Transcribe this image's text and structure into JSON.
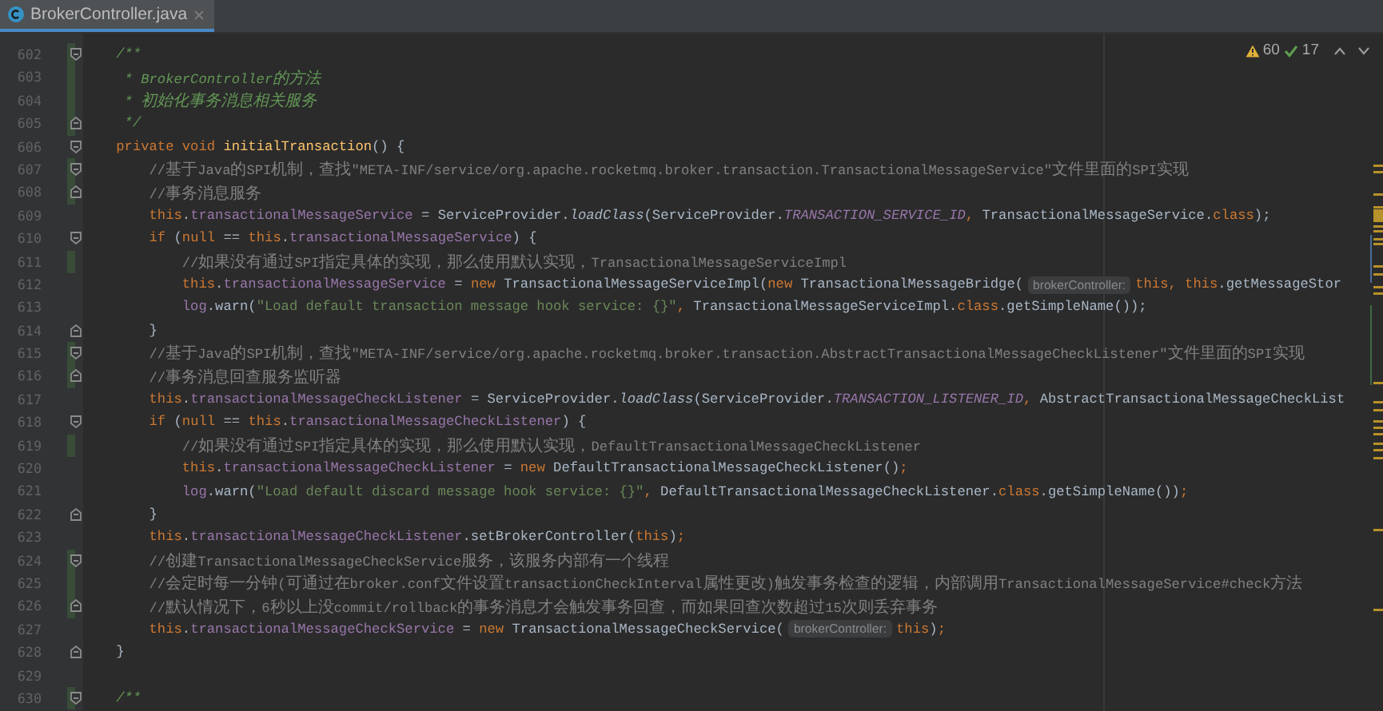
{
  "tabs": [
    {
      "title": "BrokerController.java",
      "selected": true
    }
  ],
  "inspections": {
    "warnings": "60",
    "weak_warnings": "17"
  },
  "lines": [
    {
      "number": "602",
      "fold_start": true,
      "fold_end": false,
      "changed": true,
      "tokens": [
        {
          "kind": "doc",
          "text": "    /**"
        }
      ]
    },
    {
      "number": "603",
      "fold_start": false,
      "fold_end": false,
      "changed": true,
      "tokens": [
        {
          "kind": "doc",
          "text": "     * BrokerController的方法"
        }
      ]
    },
    {
      "number": "604",
      "fold_start": false,
      "fold_end": false,
      "changed": true,
      "tokens": [
        {
          "kind": "doc",
          "text": "     * 初始化事务消息相关服务"
        }
      ]
    },
    {
      "number": "605",
      "fold_start": false,
      "fold_end": true,
      "changed": true,
      "tokens": [
        {
          "kind": "doc",
          "text": "     */"
        }
      ]
    },
    {
      "number": "606",
      "fold_start": true,
      "fold_end": false,
      "changed": false,
      "tokens": [
        {
          "kind": "kw",
          "text": "    private void "
        },
        {
          "kind": "decl",
          "text": "initialTransaction"
        },
        {
          "kind": "plain",
          "text": "() {"
        }
      ]
    },
    {
      "number": "607",
      "fold_start": true,
      "fold_end": false,
      "changed": true,
      "tokens": [
        {
          "kind": "comment",
          "text": "        //基于Java的SPI机制，查找\"META-INF/service/org.apache.rocketmq.broker.transaction.TransactionalMessageService\"文件里面的SPI实现"
        }
      ]
    },
    {
      "number": "608",
      "fold_start": false,
      "fold_end": true,
      "changed": true,
      "tokens": [
        {
          "kind": "comment",
          "text": "        //事务消息服务"
        }
      ]
    },
    {
      "number": "609",
      "fold_start": false,
      "fold_end": false,
      "changed": false,
      "tokens": [
        {
          "kind": "kw",
          "text": "        this"
        },
        {
          "kind": "plain",
          "text": "."
        },
        {
          "kind": "field",
          "text": "transactionalMessageService"
        },
        {
          "kind": "plain",
          "text": " = ServiceProvider."
        },
        {
          "kind": "call",
          "text": "loadClass"
        },
        {
          "kind": "plain",
          "text": "(ServiceProvider."
        },
        {
          "kind": "static",
          "text": "TRANSACTION_SERVICE_ID"
        },
        {
          "kind": "kw",
          "text": ", "
        },
        {
          "kind": "plain",
          "text": "TransactionalMessageService."
        },
        {
          "kind": "kw",
          "text": "class"
        },
        {
          "kind": "plain",
          "text": ");"
        }
      ]
    },
    {
      "number": "610",
      "fold_start": true,
      "fold_end": false,
      "changed": false,
      "tokens": [
        {
          "kind": "kw",
          "text": "        if "
        },
        {
          "kind": "plain",
          "text": "("
        },
        {
          "kind": "kw",
          "text": "null"
        },
        {
          "kind": "plain",
          "text": " == "
        },
        {
          "kind": "kw",
          "text": "this"
        },
        {
          "kind": "plain",
          "text": "."
        },
        {
          "kind": "field",
          "text": "transactionalMessageService"
        },
        {
          "kind": "plain",
          "text": ") {"
        }
      ]
    },
    {
      "number": "611",
      "fold_start": false,
      "fold_end": false,
      "changed": true,
      "tokens": [
        {
          "kind": "comment",
          "text": "            //如果没有通过SPI指定具体的实现，那么使用默认实现，TransactionalMessageServiceImpl"
        }
      ]
    },
    {
      "number": "612",
      "fold_start": false,
      "fold_end": false,
      "changed": false,
      "tokens": [
        {
          "kind": "kw",
          "text": "            this"
        },
        {
          "kind": "plain",
          "text": "."
        },
        {
          "kind": "field",
          "text": "transactionalMessageService"
        },
        {
          "kind": "plain",
          "text": " = "
        },
        {
          "kind": "kw",
          "text": "new "
        },
        {
          "kind": "plain",
          "text": "TransactionalMessageServiceImpl("
        },
        {
          "kind": "kw",
          "text": "new "
        },
        {
          "kind": "plain",
          "text": "TransactionalMessageBridge("
        },
        {
          "kind": "hint",
          "text": "brokerController:"
        },
        {
          "kind": "kw",
          "text": "this, this"
        },
        {
          "kind": "plain",
          "text": ".getMessageStor"
        }
      ]
    },
    {
      "number": "613",
      "fold_start": false,
      "fold_end": false,
      "changed": false,
      "tokens": [
        {
          "kind": "field",
          "text": "            log"
        },
        {
          "kind": "plain",
          "text": ".warn("
        },
        {
          "kind": "str",
          "text": "\"Load default transaction message hook service: {}\""
        },
        {
          "kind": "kw",
          "text": ", "
        },
        {
          "kind": "plain",
          "text": "TransactionalMessageServiceImpl."
        },
        {
          "kind": "kw",
          "text": "class"
        },
        {
          "kind": "plain",
          "text": ".getSimpleName());"
        }
      ]
    },
    {
      "number": "614",
      "fold_start": false,
      "fold_end": true,
      "changed": false,
      "tokens": [
        {
          "kind": "plain",
          "text": "        }"
        }
      ]
    },
    {
      "number": "615",
      "fold_start": true,
      "fold_end": false,
      "changed": true,
      "tokens": [
        {
          "kind": "comment",
          "text": "        //基于Java的SPI机制，查找\"META-INF/service/org.apache.rocketmq.broker.transaction.AbstractTransactionalMessageCheckListener\"文件里面的SPI实现"
        }
      ]
    },
    {
      "number": "616",
      "fold_start": false,
      "fold_end": true,
      "changed": true,
      "tokens": [
        {
          "kind": "comment",
          "text": "        //事务消息回查服务监听器"
        }
      ]
    },
    {
      "number": "617",
      "fold_start": false,
      "fold_end": false,
      "changed": false,
      "tokens": [
        {
          "kind": "kw",
          "text": "        this"
        },
        {
          "kind": "plain",
          "text": "."
        },
        {
          "kind": "field",
          "text": "transactionalMessageCheckListener"
        },
        {
          "kind": "plain",
          "text": " = ServiceProvider."
        },
        {
          "kind": "call",
          "text": "loadClass"
        },
        {
          "kind": "plain",
          "text": "(ServiceProvider."
        },
        {
          "kind": "static",
          "text": "TRANSACTION_LISTENER_ID"
        },
        {
          "kind": "kw",
          "text": ", "
        },
        {
          "kind": "plain",
          "text": "AbstractTransactionalMessageCheckList"
        }
      ]
    },
    {
      "number": "618",
      "fold_start": true,
      "fold_end": false,
      "changed": false,
      "tokens": [
        {
          "kind": "kw",
          "text": "        if "
        },
        {
          "kind": "plain",
          "text": "("
        },
        {
          "kind": "kw",
          "text": "null"
        },
        {
          "kind": "plain",
          "text": " == "
        },
        {
          "kind": "kw",
          "text": "this"
        },
        {
          "kind": "plain",
          "text": "."
        },
        {
          "kind": "field",
          "text": "transactionalMessageCheckListener"
        },
        {
          "kind": "plain",
          "text": ") {"
        }
      ]
    },
    {
      "number": "619",
      "fold_start": false,
      "fold_end": false,
      "changed": true,
      "tokens": [
        {
          "kind": "comment",
          "text": "            //如果没有通过SPI指定具体的实现，那么使用默认实现，DefaultTransactionalMessageCheckListener"
        }
      ]
    },
    {
      "number": "620",
      "fold_start": false,
      "fold_end": false,
      "changed": false,
      "tokens": [
        {
          "kind": "kw",
          "text": "            this"
        },
        {
          "kind": "plain",
          "text": "."
        },
        {
          "kind": "field",
          "text": "transactionalMessageCheckListener"
        },
        {
          "kind": "plain",
          "text": " = "
        },
        {
          "kind": "kw",
          "text": "new "
        },
        {
          "kind": "plain",
          "text": "DefaultTransactionalMessageCheckListener()"
        },
        {
          "kind": "kw",
          "text": ";"
        }
      ]
    },
    {
      "number": "621",
      "fold_start": false,
      "fold_end": false,
      "changed": false,
      "tokens": [
        {
          "kind": "field",
          "text": "            log"
        },
        {
          "kind": "plain",
          "text": ".warn("
        },
        {
          "kind": "str",
          "text": "\"Load default discard message hook service: {}\""
        },
        {
          "kind": "kw",
          "text": ", "
        },
        {
          "kind": "plain",
          "text": "DefaultTransactionalMessageCheckListener."
        },
        {
          "kind": "kw",
          "text": "class"
        },
        {
          "kind": "plain",
          "text": ".getSimpleName())"
        },
        {
          "kind": "kw",
          "text": ";"
        }
      ]
    },
    {
      "number": "622",
      "fold_start": false,
      "fold_end": true,
      "changed": false,
      "tokens": [
        {
          "kind": "plain",
          "text": "        }"
        }
      ]
    },
    {
      "number": "623",
      "fold_start": false,
      "fold_end": false,
      "changed": false,
      "tokens": [
        {
          "kind": "kw",
          "text": "        this"
        },
        {
          "kind": "plain",
          "text": "."
        },
        {
          "kind": "field",
          "text": "transactionalMessageCheckListener"
        },
        {
          "kind": "plain",
          "text": ".setBrokerController("
        },
        {
          "kind": "kw",
          "text": "this"
        },
        {
          "kind": "plain",
          "text": ")"
        },
        {
          "kind": "kw",
          "text": ";"
        }
      ]
    },
    {
      "number": "624",
      "fold_start": true,
      "fold_end": false,
      "changed": true,
      "tokens": [
        {
          "kind": "comment",
          "text": "        //创建TransactionalMessageCheckService服务，该服务内部有一个线程"
        }
      ]
    },
    {
      "number": "625",
      "fold_start": false,
      "fold_end": false,
      "changed": true,
      "tokens": [
        {
          "kind": "comment",
          "text": "        //会定时每一分钟(可通过在broker.conf文件设置transactionCheckInterval属性更改)触发事务检查的逻辑，内部调用TransactionalMessageService#check方法"
        }
      ]
    },
    {
      "number": "626",
      "fold_start": false,
      "fold_end": true,
      "changed": true,
      "tokens": [
        {
          "kind": "comment",
          "text": "        //默认情况下，6秒以上没commit/rollback的事务消息才会触发事务回查，而如果回查次数超过15次则丢弃事务"
        }
      ]
    },
    {
      "number": "627",
      "fold_start": false,
      "fold_end": false,
      "changed": false,
      "tokens": [
        {
          "kind": "kw",
          "text": "        this"
        },
        {
          "kind": "plain",
          "text": "."
        },
        {
          "kind": "field",
          "text": "transactionalMessageCheckService"
        },
        {
          "kind": "plain",
          "text": " = "
        },
        {
          "kind": "kw",
          "text": "new "
        },
        {
          "kind": "plain",
          "text": "TransactionalMessageCheckService("
        },
        {
          "kind": "hint",
          "text": "brokerController:"
        },
        {
          "kind": "kw",
          "text": "this"
        },
        {
          "kind": "plain",
          "text": ")"
        },
        {
          "kind": "kw",
          "text": ";"
        }
      ]
    },
    {
      "number": "628",
      "fold_start": false,
      "fold_end": true,
      "changed": false,
      "tokens": [
        {
          "kind": "plain",
          "text": "    }"
        }
      ]
    },
    {
      "number": "629",
      "fold_start": false,
      "fold_end": false,
      "changed": false
    },
    {
      "number": "630",
      "fold_start": true,
      "fold_end": false,
      "changed": true,
      "tokens": [
        {
          "kind": "doc",
          "text": "    /**"
        }
      ]
    }
  ]
}
